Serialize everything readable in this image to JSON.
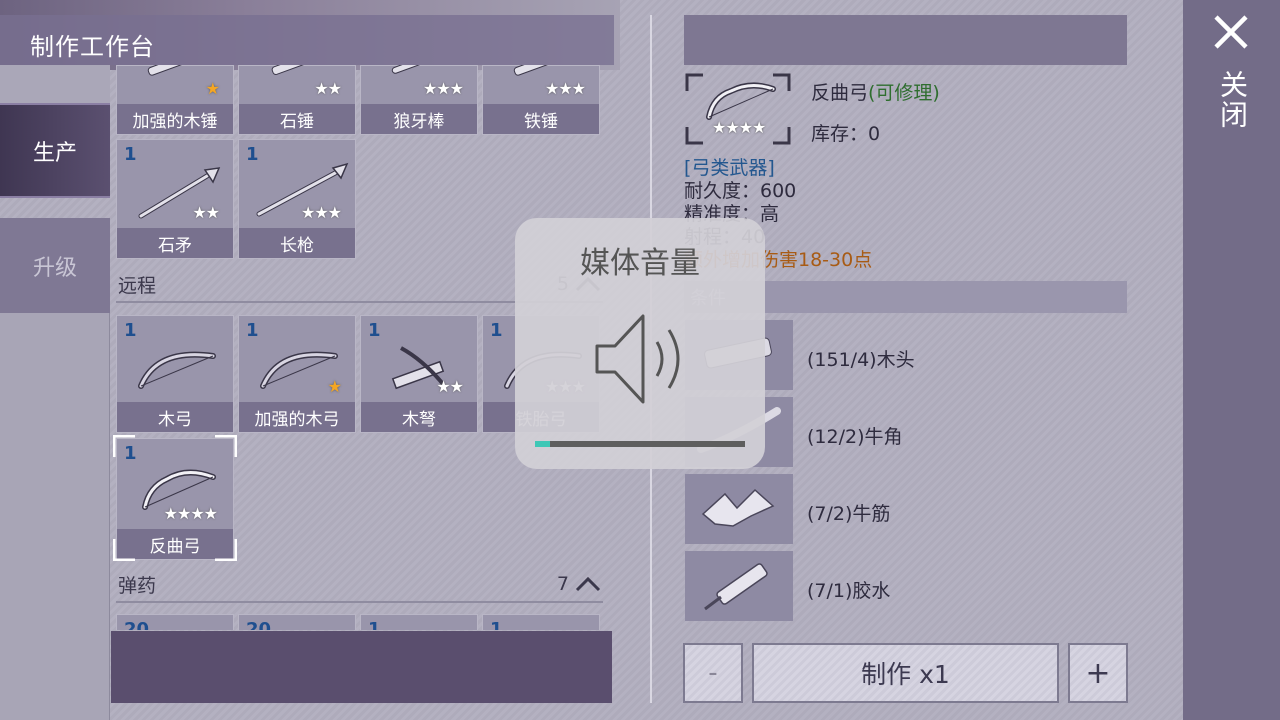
{
  "header": {
    "title": "制作工作台"
  },
  "tabs": [
    {
      "label": "生产",
      "active": true
    },
    {
      "label": "升级",
      "active": false
    }
  ],
  "melee_items": [
    {
      "label": "加强的木锤",
      "stars": "★",
      "star_color": "gold"
    },
    {
      "label": "石锤",
      "stars": "★★",
      "star_color": "white"
    },
    {
      "label": "狼牙棒",
      "stars": "★★★",
      "star_color": "white"
    },
    {
      "label": "铁锤",
      "stars": "★★★",
      "star_color": "white"
    },
    {
      "label": "石矛",
      "count": "1",
      "stars": "★★",
      "star_color": "white"
    },
    {
      "label": "长枪",
      "count": "1",
      "stars": "★★★",
      "star_color": "white"
    }
  ],
  "ranged_section": {
    "title": "远程",
    "count": "5"
  },
  "ranged_items": [
    {
      "label": "木弓",
      "count": "1",
      "stars": "",
      "star_color": "white"
    },
    {
      "label": "加强的木弓",
      "count": "1",
      "stars": "★",
      "star_color": "gold"
    },
    {
      "label": "木弩",
      "count": "1",
      "stars": "★★",
      "star_color": "white"
    },
    {
      "label": "铁胎弓",
      "count": "1",
      "stars": "★★★",
      "star_color": "white"
    },
    {
      "label": "反曲弓",
      "count": "1",
      "stars": "★★★★",
      "star_color": "white",
      "selected": true
    }
  ],
  "ammo_section": {
    "title": "弹药",
    "count": "7"
  },
  "ammo_items": [
    {
      "count": "20"
    },
    {
      "count": "20"
    },
    {
      "count": "1"
    },
    {
      "count": "1"
    }
  ],
  "detail": {
    "name": "反曲弓",
    "repairable": "(可修理)",
    "stars": "★★★★",
    "stock_label": "库存：",
    "stock_value": "0",
    "category": "[弓类武器]",
    "durability": "耐久度：600",
    "accuracy": "精准度：高",
    "range": "射程：40",
    "effect": "额外增加伤害18-30点",
    "materials_title": "条件",
    "materials": [
      {
        "text": "(151/4)木头",
        "icon": "wood-icon"
      },
      {
        "text": "(12/2)牛角",
        "icon": "horn-icon"
      },
      {
        "text": "(7/2)牛筋",
        "icon": "tendon-icon"
      },
      {
        "text": "(7/1)胶水",
        "icon": "glue-icon"
      }
    ]
  },
  "actions": {
    "minus": "-",
    "craft": "制作 x1",
    "plus": "+"
  },
  "close": {
    "label": "关闭"
  },
  "volume_overlay": {
    "title": "媒体音量",
    "level": 0.07,
    "fill_color": "#3ec7b6"
  }
}
